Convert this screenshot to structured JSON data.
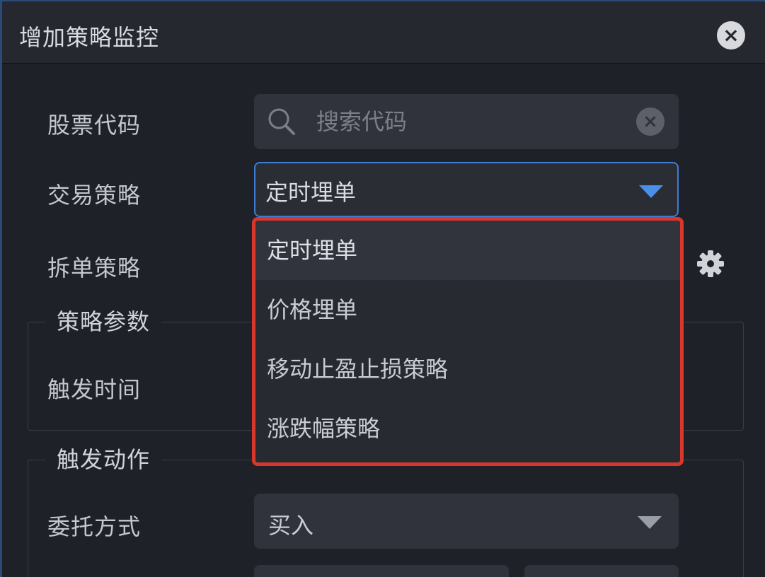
{
  "dialog": {
    "title": "增加策略监控",
    "close_icon": "close-circle-icon"
  },
  "form": {
    "stock_code_label": "股票代码",
    "search_placeholder": "搜索代码",
    "search_value": "",
    "strategy_label": "交易策略",
    "strategy_selected": "定时埋单",
    "split_label": "拆单策略",
    "trigger_time_label": "触发时间",
    "order_type_label": "委托方式",
    "order_type_selected": "买入"
  },
  "groups": {
    "params_title": "策略参数",
    "action_title": "触发动作"
  },
  "dropdown": {
    "options": [
      "定时埋单",
      "价格埋单",
      "移动止盈止损策略",
      "涨跌幅策略"
    ],
    "selected_index": 0
  },
  "colors": {
    "accent_blue": "#3d7ed4",
    "highlight_red": "#d9362c",
    "background": "#1e2128"
  }
}
